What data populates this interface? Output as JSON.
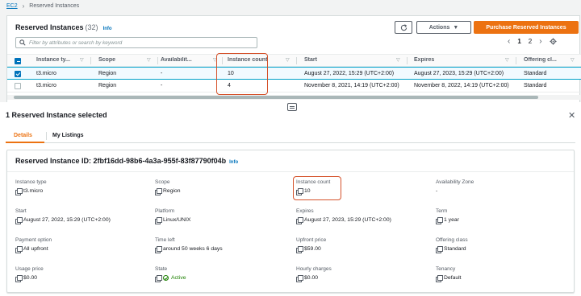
{
  "breadcrumb": {
    "root": "EC2",
    "current": "Reserved Instances"
  },
  "panel": {
    "title": "Reserved Instances",
    "count": "(32)",
    "info": "Info"
  },
  "toolbar": {
    "actions_label": "Actions",
    "purchase_label": "Purchase Reserved Instances"
  },
  "search": {
    "placeholder": "Filter by attributes or search by keyword"
  },
  "pagination": {
    "page1": "1",
    "page2": "2"
  },
  "table": {
    "headers": [
      "Instance ty...",
      "Scope",
      "Availabilit...",
      "Instance count",
      "Start",
      "Expires",
      "Offering cl..."
    ],
    "rows": [
      {
        "selected": true,
        "cells": [
          "t3.micro",
          "Region",
          "-",
          "10",
          "August 27, 2022, 15:29 (UTC+2:00)",
          "August 27, 2023, 15:29 (UTC+2:00)",
          "Standard"
        ]
      },
      {
        "selected": false,
        "cells": [
          "t3.micro",
          "Region",
          "-",
          "4",
          "November 8, 2021, 14:19 (UTC+2:00)",
          "November 8, 2022, 14:19 (UTC+2:00)",
          "Standard"
        ]
      }
    ]
  },
  "split": {
    "title": "1 Reserved Instance selected"
  },
  "tabs": {
    "details": "Details",
    "listings": "My Listings"
  },
  "detail": {
    "title": "Reserved Instance ID: 2fbf16dd-98b6-4a3a-955f-83f87790f04b",
    "info": "Info",
    "fields": [
      {
        "label": "Instance type",
        "value": "t3.micro"
      },
      {
        "label": "Scope",
        "value": "Region"
      },
      {
        "label": "Instance count",
        "value": "10"
      },
      {
        "label": "Availability Zone",
        "value": "-"
      },
      {
        "label": "Start",
        "value": "August 27, 2022, 15:29 (UTC+2:00)"
      },
      {
        "label": "Platform",
        "value": "Linux/UNIX"
      },
      {
        "label": "Expires",
        "value": "August 27, 2023, 15:29 (UTC+2:00)"
      },
      {
        "label": "Term",
        "value": "1 year"
      },
      {
        "label": "Payment option",
        "value": "All upfront"
      },
      {
        "label": "Time left",
        "value": "around 50 weeks 6 days"
      },
      {
        "label": "Upfront price",
        "value": "$59.00"
      },
      {
        "label": "Offering class",
        "value": "Standard"
      },
      {
        "label": "Usage price",
        "value": "$0.00"
      },
      {
        "label": "State",
        "value": "Active"
      },
      {
        "label": "Hourly charges",
        "value": "$0.00"
      },
      {
        "label": "Tenancy",
        "value": "Default"
      }
    ]
  },
  "colors": {
    "accent": "#ec7211",
    "link": "#0073bb",
    "highlight": "#d5522b",
    "active": "#1d8102"
  }
}
